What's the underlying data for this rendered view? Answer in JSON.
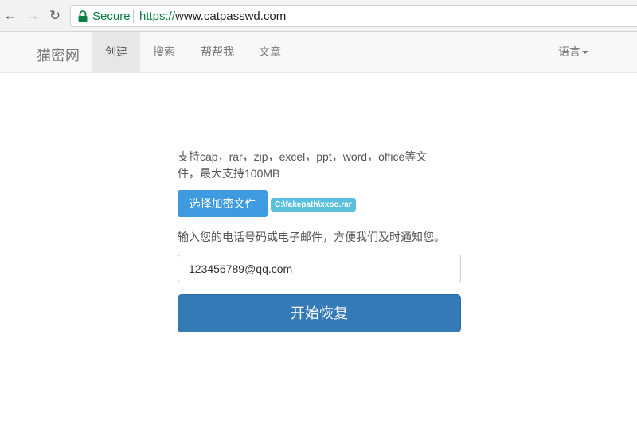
{
  "browser": {
    "back_icon": "arrow-left-icon",
    "forward_icon": "arrow-right-icon",
    "reload_icon": "reload-icon",
    "secure_label": "Secure",
    "url_scheme": "https://",
    "url_host": "www.catpasswd.com",
    "secure_color": "#0b8043"
  },
  "navbar": {
    "brand": "猫密网",
    "items": [
      {
        "label": "创建",
        "active": true
      },
      {
        "label": "搜索",
        "active": false
      },
      {
        "label": "帮帮我",
        "active": false
      },
      {
        "label": "文章",
        "active": false
      }
    ],
    "language_label": "语言"
  },
  "main": {
    "description": "支持cap，rar，zip，excel，ppt，word，office等文件，最大支持100MB",
    "file_button_label": "选择加密文件",
    "file_name": "C:\\fakepath\\xxoo.rar",
    "contact_hint": "输入您的电话号码或电子邮件，方便我们及时通知您。",
    "contact_value": "123456789@qq.com",
    "submit_label": "开始恢复"
  },
  "colors": {
    "primary": "#337ab7",
    "file_button": "#3e9be0",
    "badge": "#5bc0de"
  }
}
